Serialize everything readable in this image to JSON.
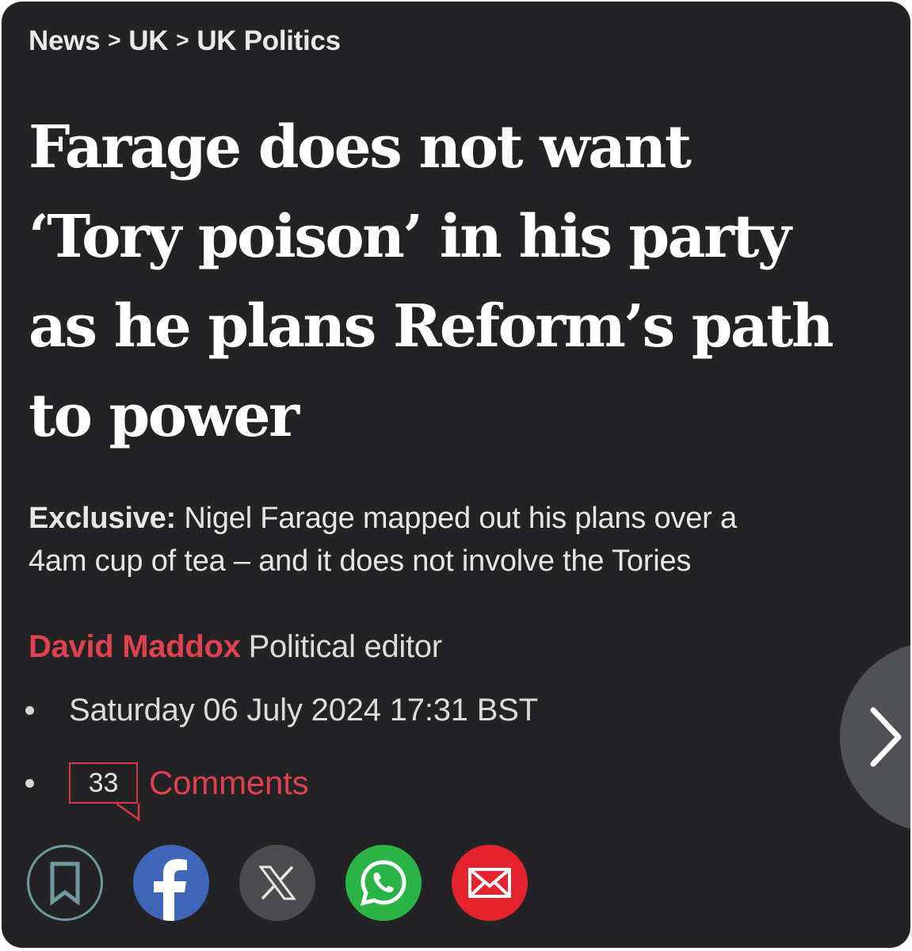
{
  "breadcrumb": {
    "items": [
      "News",
      "UK",
      "UK Politics"
    ],
    "separator": ">"
  },
  "headline": {
    "lines": [
      "Farage does not want",
      "‘Tory poison’ in his party",
      "as he plans Reform’s path",
      "to power"
    ]
  },
  "standfirst": {
    "label": "Exclusive:",
    "line1": "Nigel Farage mapped out his plans over a",
    "line2": "4am cup of tea – and it does not involve the Tories"
  },
  "byline": {
    "author": "David Maddox",
    "role": "Political editor"
  },
  "date": "Saturday 06 July 2024 17:31 BST",
  "comments": {
    "count": "33",
    "label": "Comments"
  },
  "share_buttons": [
    {
      "name": "bookmark",
      "icon": "bookmark-icon",
      "color": "#6e9c9e"
    },
    {
      "name": "facebook",
      "icon": "facebook-icon",
      "color": "#3f66b8"
    },
    {
      "name": "x",
      "icon": "x-icon",
      "color": "#4c4c4f"
    },
    {
      "name": "whatsapp",
      "icon": "whatsapp-icon",
      "color": "#2ab446"
    },
    {
      "name": "email",
      "icon": "mail-icon",
      "color": "#e4232f"
    }
  ],
  "next_button": {
    "icon": "chevron-right-icon"
  },
  "colors": {
    "background": "#232224",
    "accent_red": "#e0414f",
    "text": "#ffffff"
  }
}
